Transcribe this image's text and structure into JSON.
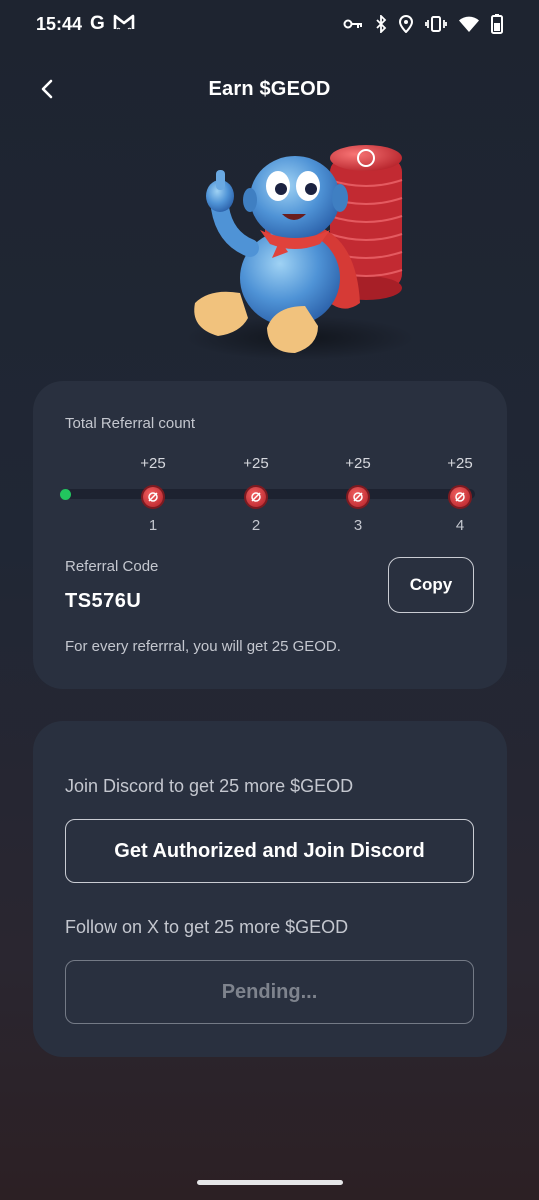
{
  "status_bar": {
    "time": "15:44",
    "icons": [
      "google-g-icon",
      "gmail-icon",
      "vpn-key-icon",
      "bluetooth-icon",
      "location-icon",
      "vibrate-icon",
      "wifi-icon",
      "battery-icon"
    ]
  },
  "header": {
    "title": "Earn $GEOD",
    "back_icon": "chevron-left-icon"
  },
  "hero": {
    "icon": "robot-mascot-with-coins"
  },
  "referral": {
    "title": "Total Referral count",
    "progress_value": 0,
    "accent_color": "#22c55e",
    "coin_color": "#d93a3f",
    "milestones": [
      {
        "reward": "+25",
        "count": "1"
      },
      {
        "reward": "+25",
        "count": "2"
      },
      {
        "reward": "+25",
        "count": "3"
      },
      {
        "reward": "+25",
        "count": "4"
      }
    ],
    "code_label": "Referral Code",
    "code": "TS576U",
    "copy_label": "Copy",
    "note": "For every referrral, you will get 25 GEOD."
  },
  "tasks": {
    "discord": {
      "label": "Join Discord to get 25 more $GEOD",
      "button": "Get Authorized and Join Discord"
    },
    "x": {
      "label": "Follow on X to get 25 more $GEOD",
      "button": "Pending..."
    }
  }
}
